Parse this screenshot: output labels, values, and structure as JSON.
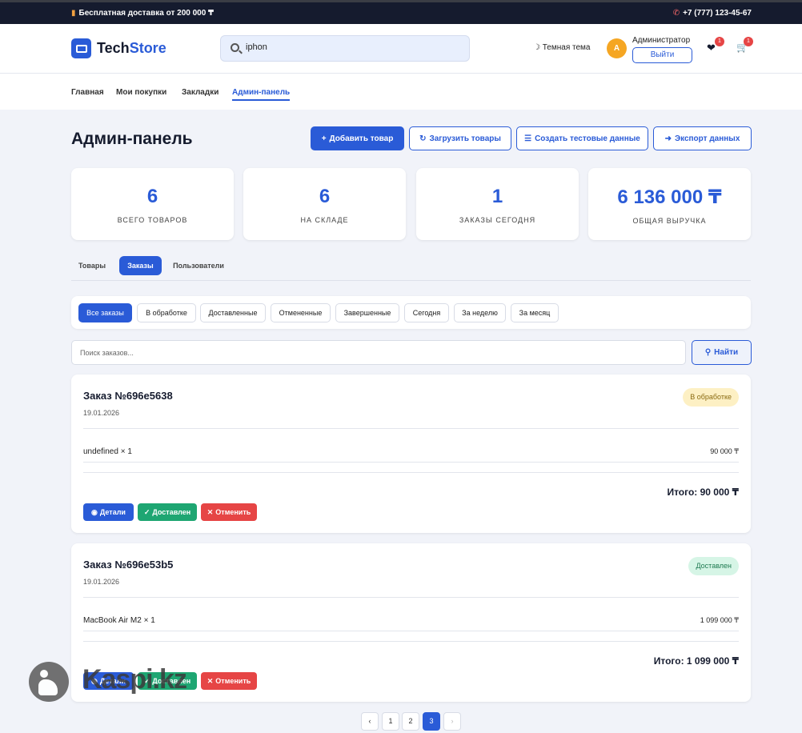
{
  "topbar": {
    "promo": "Бесплатная доставка от 200 000 ₸",
    "promo_icon": "truck-icon",
    "phone": "+7 (777) 123-45-67",
    "phone_icon": "phone-icon"
  },
  "header": {
    "logo_part1": "Tech",
    "logo_part2": "Store",
    "search_value": "iphon",
    "theme_label": "Темная тема",
    "avatar_letter": "А",
    "user_name": "Администратор",
    "logout_label": "Выйти",
    "wishlist_count": "1",
    "cart_count": "1"
  },
  "nav": {
    "items": [
      "Главная",
      "Мои покупки",
      "Закладки",
      "Админ-панель"
    ]
  },
  "page": {
    "title": "Админ-панель",
    "actions": {
      "add": "Добавить товар",
      "upload": "Загрузить товары",
      "create_test": "Создать тестовые данные",
      "export": "Экспорт данных"
    }
  },
  "stats": [
    {
      "value": "6",
      "label": "ВСЕГО ТОВАРОВ"
    },
    {
      "value": "6",
      "label": "НА СКЛАДЕ"
    },
    {
      "value": "1",
      "label": "ЗАКАЗЫ СЕГОДНЯ"
    },
    {
      "value": "6 136 000 ₸",
      "label": "ОБЩАЯ ВЫРУЧКА"
    }
  ],
  "tabs": [
    "Товары",
    "Заказы",
    "Пользователи"
  ],
  "filters": [
    "Все заказы",
    "В обработке",
    "Доставленные",
    "Отмененные",
    "Завершенные",
    "Сегодня",
    "За неделю",
    "За месяц"
  ],
  "order_search": {
    "placeholder": "Поиск заказов...",
    "button": "Найти"
  },
  "orders": [
    {
      "title": "Заказ №696e5638",
      "date": "19.01.2026",
      "status": "В обработке",
      "status_bg": "#fdf0c4",
      "status_color": "#8a6a10",
      "item": "undefined × 1",
      "item_price": "90 000 ₸",
      "total": "Итого: 90 000 ₸",
      "btn_details": "Детали",
      "btn_delivered": "Доставлен",
      "btn_cancel": "Отменить"
    },
    {
      "title": "Заказ №696e53b5",
      "date": "19.01.2026",
      "status": "Доставлен",
      "status_bg": "#d6f5e6",
      "status_color": "#1d7a50",
      "item": "MacBook Air M2 × 1",
      "item_price": "1 099 000 ₸",
      "total": "Итого: 1 099 000 ₸",
      "btn_details": "Детали",
      "btn_delivered": "Доставлен",
      "btn_cancel": "Отменить"
    }
  ],
  "pagination": {
    "prev": "‹",
    "pages": [
      "1",
      "2",
      "3"
    ],
    "current": "3",
    "next": "›"
  },
  "watermark": {
    "text": "Kaspi.kz"
  },
  "colors": {
    "accent": "#2a5bd7",
    "topbar_bg": "#151b2e",
    "success": "#1ea672",
    "danger": "#e64545"
  }
}
